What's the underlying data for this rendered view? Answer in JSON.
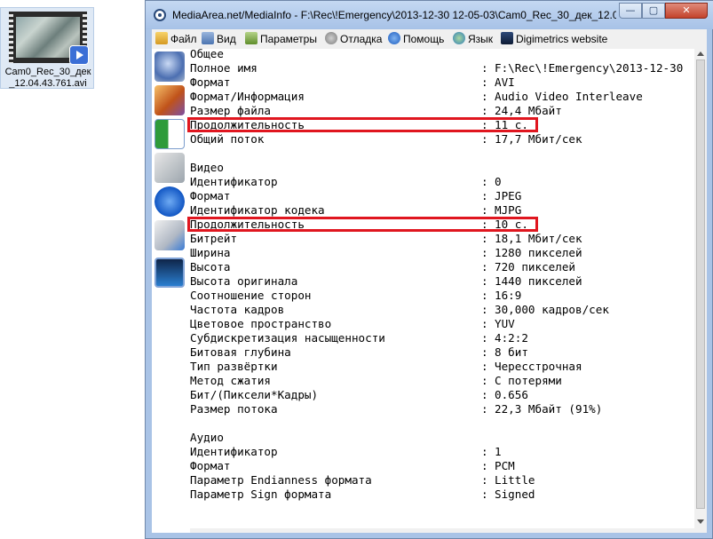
{
  "desktop": {
    "file_label_line1": "Cam0_Rec_30_дек",
    "file_label_line2": "_12.04.43.761.avi"
  },
  "window": {
    "title": "MediaArea.net/MediaInfo - F:\\Rec\\!Emergency\\2013-12-30 12-05-03\\Cam0_Rec_30_дек_12.0",
    "controls": {
      "minimize": "—",
      "maximize": "▢",
      "close": "✕"
    }
  },
  "menu": {
    "file": "Файл",
    "view": "Вид",
    "options": "Параметры",
    "debug": "Отладка",
    "help": "Помощь",
    "language": "Язык",
    "digimetrics": "Digimetrics website"
  },
  "colors": {
    "highlight": "#e0161f"
  },
  "info": {
    "general": {
      "header": "Общее",
      "rows": [
        {
          "k": "Полное имя",
          "v": "F:\\Rec\\!Emergency\\2013-12-30"
        },
        {
          "k": "Формат",
          "v": "AVI"
        },
        {
          "k": "Формат/Информация",
          "v": "Audio Video Interleave"
        },
        {
          "k": "Размер файла",
          "v": "24,4 Мбайт"
        },
        {
          "k": "Продолжительность",
          "v": "11 с."
        },
        {
          "k": "Общий поток",
          "v": "17,7 Мбит/сек"
        }
      ]
    },
    "video": {
      "header": "Видео",
      "rows": [
        {
          "k": "Идентификатор",
          "v": "0"
        },
        {
          "k": "Формат",
          "v": "JPEG"
        },
        {
          "k": "Идентификатор кодека",
          "v": "MJPG"
        },
        {
          "k": "Продолжительность",
          "v": "10 с."
        },
        {
          "k": "Битрейт",
          "v": "18,1 Мбит/сек"
        },
        {
          "k": "Ширина",
          "v": "1280 пикселей"
        },
        {
          "k": "Высота",
          "v": "720 пикселей"
        },
        {
          "k": "Высота оригинала",
          "v": "1440 пикселей"
        },
        {
          "k": "Соотношение сторон",
          "v": "16:9"
        },
        {
          "k": "Частота кадров",
          "v": "30,000 кадров/сек"
        },
        {
          "k": "Цветовое пространство",
          "v": "YUV"
        },
        {
          "k": "Субдискретизация насыщенности",
          "v": "4:2:2"
        },
        {
          "k": "Битовая глубина",
          "v": "8 бит"
        },
        {
          "k": "Тип развёртки",
          "v": "Чересстрочная"
        },
        {
          "k": "Метод сжатия",
          "v": "С потерями"
        },
        {
          "k": "Бит/(Пиксели*Кадры)",
          "v": "0.656"
        },
        {
          "k": "Размер потока",
          "v": "22,3 Мбайт (91%)"
        }
      ]
    },
    "audio": {
      "header": "Аудио",
      "rows": [
        {
          "k": "Идентификатор",
          "v": "1"
        },
        {
          "k": "Формат",
          "v": "PCM"
        },
        {
          "k": "Параметр Endianness формата",
          "v": "Little"
        },
        {
          "k": "Параметр Sign формата",
          "v": "Signed"
        }
      ]
    }
  }
}
